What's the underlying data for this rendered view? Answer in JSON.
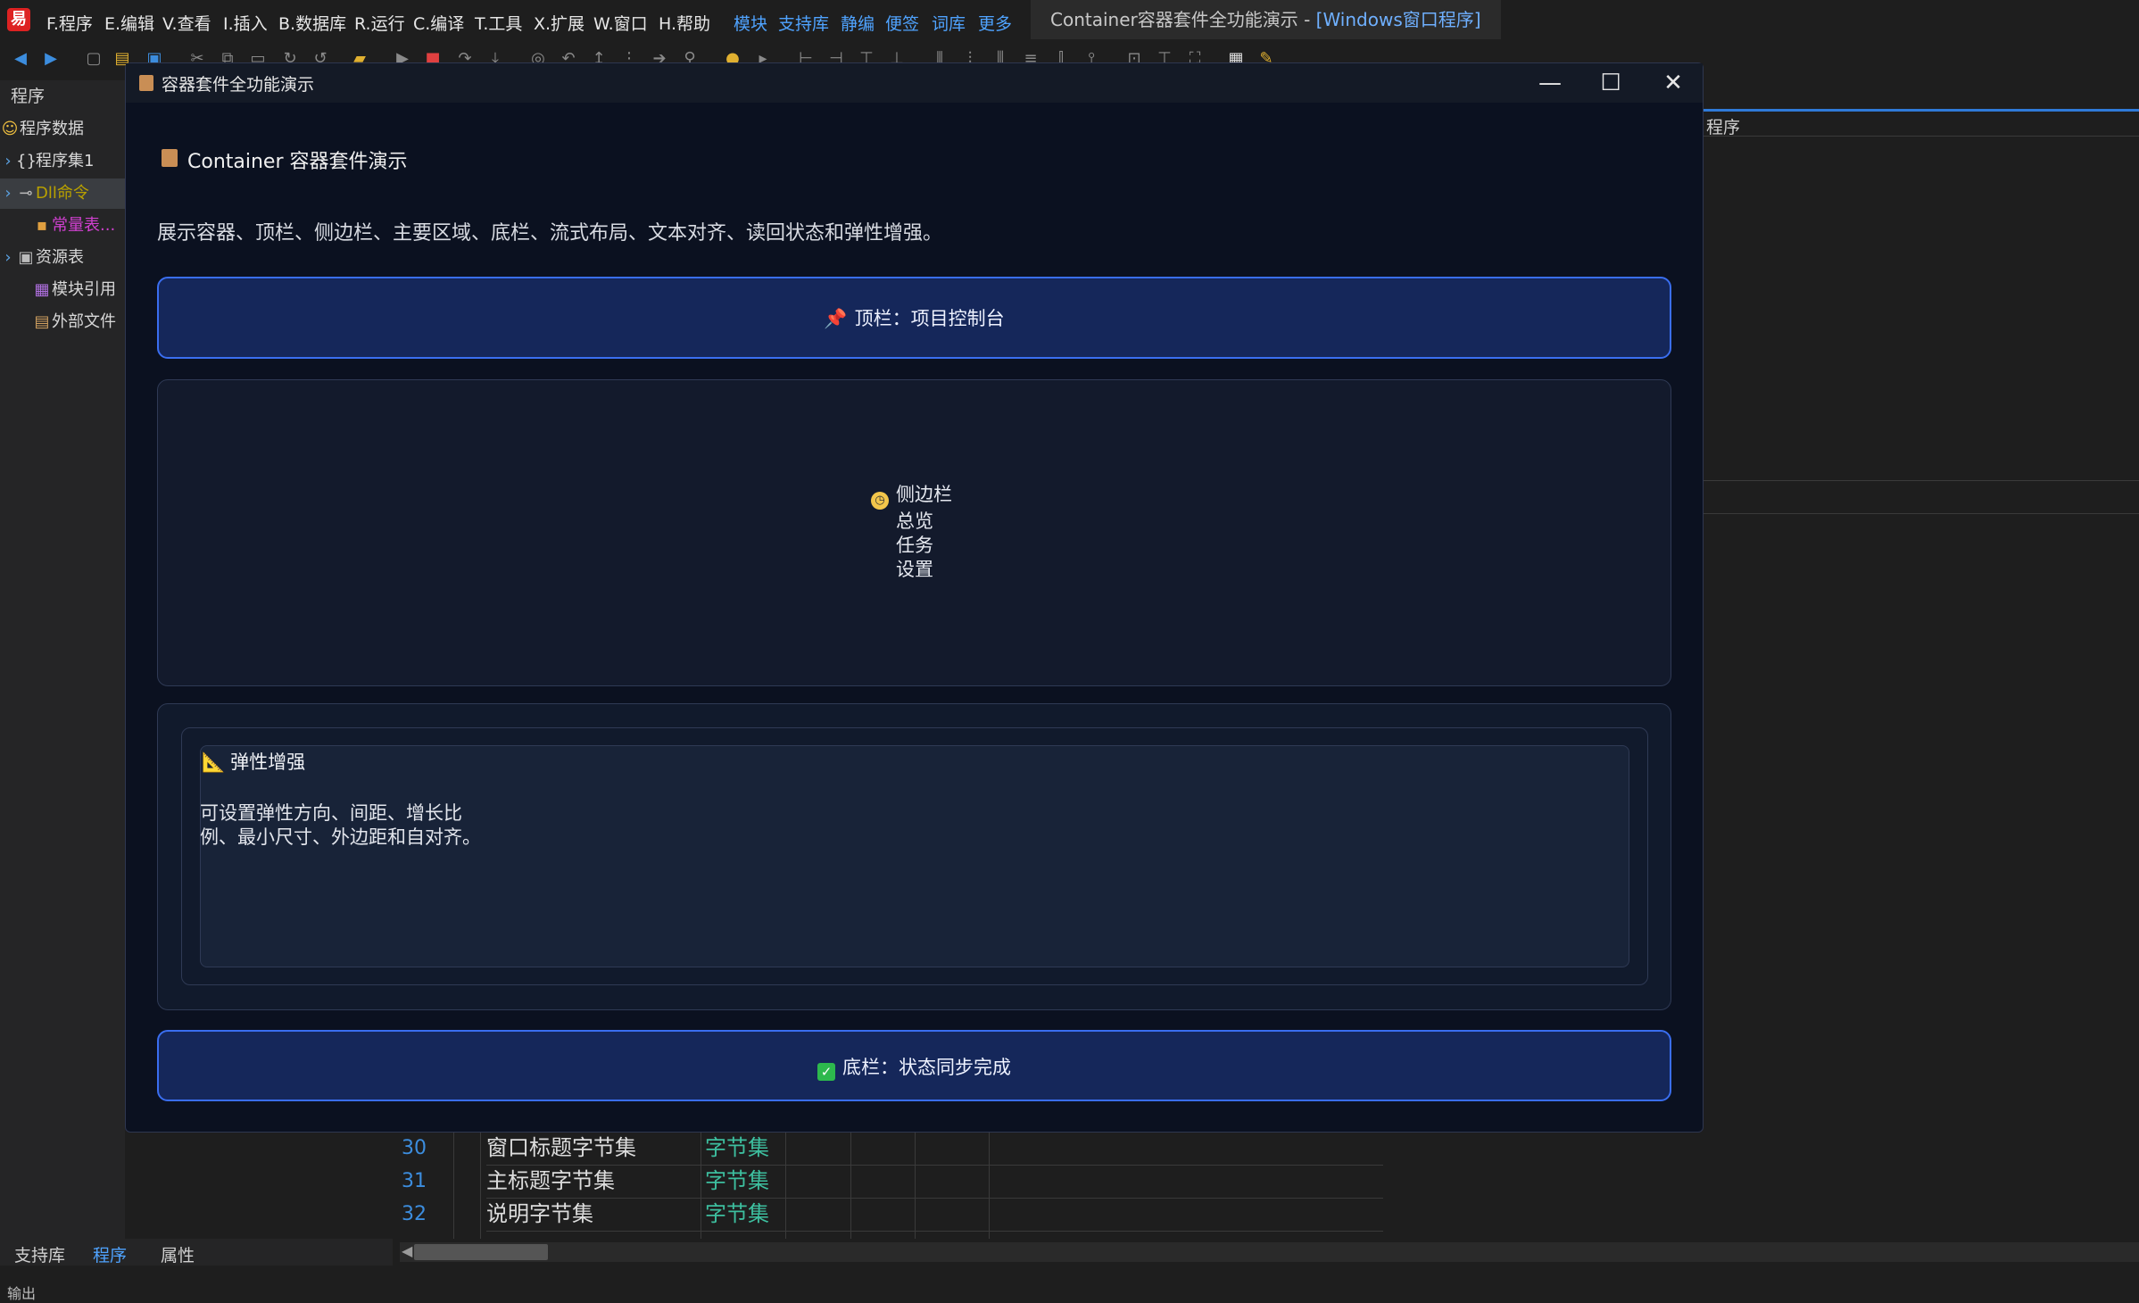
{
  "ide": {
    "menu": [
      "F.程序",
      "E.编辑",
      "V.查看",
      "I.插入",
      "B.数据库",
      "R.运行",
      "C.编译",
      "T.工具",
      "X.扩展",
      "W.窗口",
      "H.帮助"
    ],
    "quick_links": [
      "模块",
      "支持库",
      "静编",
      "便签",
      "词库",
      "更多"
    ],
    "title_prefix": "Container容器套件全功能演示 - ",
    "title_mode": "[Windows窗口程序]"
  },
  "left_panel": {
    "header": "程序",
    "items": [
      {
        "label": "程序数据",
        "icon": "smiley-icon"
      },
      {
        "label": "程序集1",
        "icon": "braces-icon"
      },
      {
        "label": "Dll命令",
        "icon": "dll-icon"
      },
      {
        "label": "常量表...",
        "icon": "constants-icon"
      },
      {
        "label": "资源表",
        "icon": "resource-icon"
      },
      {
        "label": "模块引用",
        "icon": "module-icon"
      },
      {
        "label": "外部文件",
        "icon": "external-file-icon"
      }
    ]
  },
  "editor": {
    "tab_label": "程序"
  },
  "data_table": {
    "rows": [
      {
        "num": "30",
        "name": "窗口标题字节集",
        "type": "字节集"
      },
      {
        "num": "31",
        "name": "主标题字节集",
        "type": "字节集"
      },
      {
        "num": "32",
        "name": "说明字节集",
        "type": "字节集"
      }
    ]
  },
  "bottom": {
    "tabs": [
      "支持库",
      "程序",
      "属性"
    ],
    "output_label": "输出"
  },
  "dialog": {
    "window_title": "容器套件全功能演示",
    "header": "Container 容器套件演示",
    "description": "展示容器、顶栏、侧边栏、主要区域、底栏、流式布局、文本对齐、读回状态和弹性增强。",
    "topbar_text": "顶栏：项目控制台",
    "sidebar": {
      "title": "侧边栏",
      "items": [
        "总览",
        "任务",
        "设置"
      ]
    },
    "flex": {
      "title": "弹性增强",
      "desc_line1": "可设置弹性方向、间距、增长比",
      "desc_line2": "例、最小尺寸、外边距和自对齐。"
    },
    "bottombar_text": "底栏：状态同步完成"
  },
  "colors": {
    "dialog_bg": "#0b1120",
    "bar_bg": "#15275a",
    "bar_border": "#3a6ef0",
    "accent": "#4fa3ff"
  }
}
